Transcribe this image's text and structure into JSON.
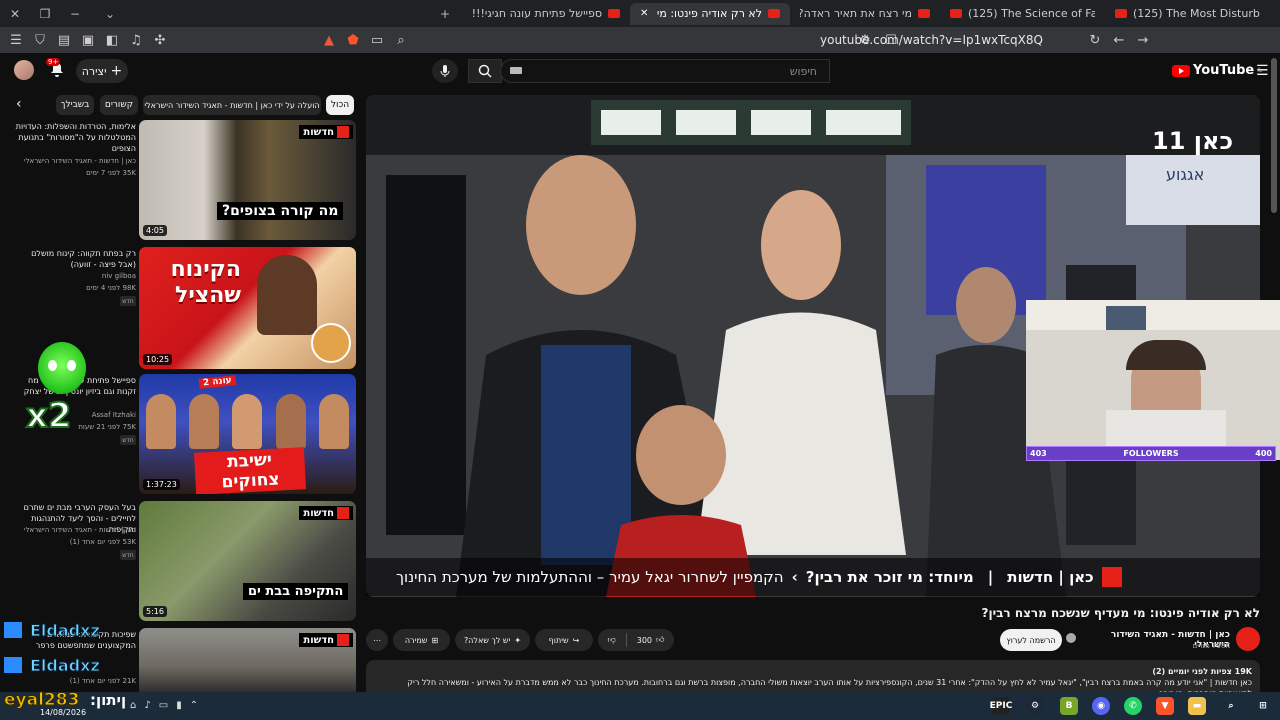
{
  "browser": {
    "tabs": [
      {
        "label": "ספיישל פתיחת עונה חגיגי!!! מח (125)",
        "active": false
      },
      {
        "label": "לא רק אודיה פינטו: מי מעדיף (125)",
        "active": true
      },
      {
        "label": "מי רצח את תאיר ראדה? (125)",
        "active": false
      },
      {
        "label": "(125) The Science of Fat - YouTube",
        "active": false
      },
      {
        "label": "(125) The Most Disturbing Discord M",
        "active": false
      }
    ],
    "url": "youtube.com/watch?v=Ip1wxTcqX8Q"
  },
  "youtube": {
    "logo": "YouTube",
    "logo_sup": "IL",
    "search_placeholder": "חיפוש",
    "create_label": "יצירה",
    "notification_count": "9+"
  },
  "chips": [
    {
      "label": "הכול",
      "selected": true
    },
    {
      "label": "הועלה על ידי כאן | חדשות - תאגיד השידור הישראלי",
      "selected": false
    },
    {
      "label": "קשורים",
      "selected": false
    },
    {
      "label": "בשבילך",
      "selected": false
    }
  ],
  "recommendations": [
    {
      "title": "אלימות, הטרדות והשפלות: העדויות המטלטלות על ה\"מסורות\" בתנועת הצופים",
      "channel": "כאן | חדשות - תאגיד השידור הישראלי",
      "meta": "35K  לפני 7 ימים",
      "duration": "4:05",
      "badge": "",
      "thumb_text": "מה קורה בצופים?",
      "thumb_tag": "חדשות"
    },
    {
      "title": "רק בפתח תקווה: קינוח מושלם (אבל פיצה - זוועה)",
      "channel": "niv gilboa",
      "meta": "98K  לפני 4 ימים",
      "duration": "10:25",
      "badge": "חדש",
      "thumb_text": "הקינוח שהציל",
      "thumb_tag": ""
    },
    {
      "title": "ספיישל פתיחת עונה חגיגי!!! מח זקנות וגם ביזיון יונס | גג של יצחק",
      "channel": "Assaf Itzhaki",
      "meta": "75K  לפני 21 שעות",
      "duration": "1:37:23",
      "badge": "חדש",
      "thumb_text": "ישיבת צחוקים",
      "thumb_tag": "עונה 2"
    },
    {
      "title": "בעל העסק הערבי מבת ים שתרם לחיילים - והסך ליעד להתנהגות ותקיפות",
      "channel": "כאן | חדשות - תאגיד השידור הישראלי",
      "meta": "53K  לפני יום אחד (1)",
      "duration": "5:16",
      "badge": "חדש",
      "thumb_text": "התקיפה בבת ים",
      "thumb_tag": "חדשות"
    },
    {
      "title": "שפיכות תקשורת: שמוזאים המקצוענים שמתפשטם פרפר",
      "channel": "",
      "meta": "21K  לפני יום אחד (1)",
      "duration": "",
      "badge": "",
      "thumb_text": "",
      "thumb_tag": "חדשות"
    }
  ],
  "player": {
    "channel_watermark": "כאן 11",
    "lower_third_brand": "כאן | חדשות",
    "lower_third_special": "מיוחד: מי זוכר את רבין?",
    "lower_third_text": "הקמפיין לשחרור יגאל עמיר – וההתעלמות של מערכת החינוך",
    "sign_text": "אגגוע",
    "followers_left": "403",
    "followers_label": "FOLLOWERS",
    "followers_right": "400"
  },
  "video": {
    "title": "לא רק אודיה פינטו: מי מעדיף שנשכח מרצח רבין?",
    "channel_name": "כאן | חדשות - תאגיד השידור הישראלי",
    "subscribers": "798K מנויים",
    "subscribe_label": "הרשמה לערוץ",
    "like_count": "300",
    "share_label": "שיתוף",
    "ask_label": "יש לך שאלה?",
    "save_label": "שמירה",
    "views_line": "19K צפיות  לפני יומיים (2)",
    "description": "כאן חדשות | \"אני יודע מה קרה באמת ברצח רבין\", \"יגאל עמיר לא לחץ על ההדק\": אחרי 31 שנים, הקונספירציות על אותו הערב יוצאות משולי החברה, מופצות ברשת וגם ברחובות. מערכת החינוך כבר לא ממש מדברת על האירוע - ומשאירה חלל ריק לתיאוריות מופרכות. מי זוכר"
  },
  "overlays": {
    "multiplier": "x2",
    "name1": "Eldadxz",
    "name2": "Eldadxz",
    "ticker": "eyal283",
    "ticker2": "ןיתון:"
  },
  "taskbar": {
    "date": "14/08/2026",
    "apps": [
      "EPIC",
      "Steam",
      "B",
      "Discord",
      "Phone",
      "WhatsApp",
      "Brave",
      "Explorer",
      "Search",
      "Windows"
    ]
  }
}
